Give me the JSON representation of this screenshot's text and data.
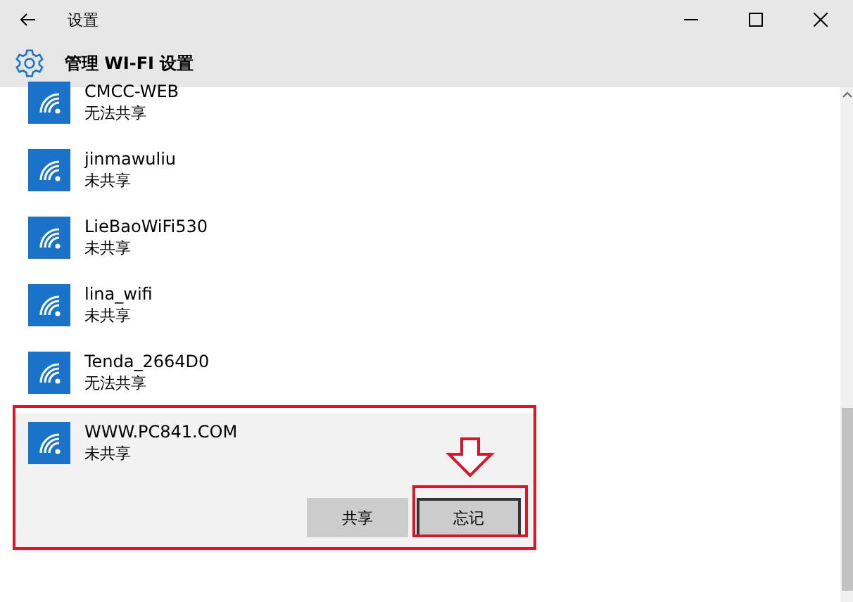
{
  "window": {
    "title": "设置"
  },
  "header": {
    "title": "管理 WI-FI 设置"
  },
  "networks": [
    {
      "name": "CMCC-WEB",
      "status": "无法共享",
      "selected": false
    },
    {
      "name": "jinmawuliu",
      "status": "未共享",
      "selected": false
    },
    {
      "name": "LieBaoWiFi530",
      "status": "未共享",
      "selected": false
    },
    {
      "name": "lina_wifi",
      "status": "未共享",
      "selected": false
    },
    {
      "name": "Tenda_2664D0",
      "status": "无法共享",
      "selected": false
    },
    {
      "name": "WWW.PC841.COM",
      "status": "未共享",
      "selected": true
    }
  ],
  "actions": [
    {
      "label": "共享",
      "focused": false
    },
    {
      "label": "忘记",
      "focused": true
    }
  ]
}
